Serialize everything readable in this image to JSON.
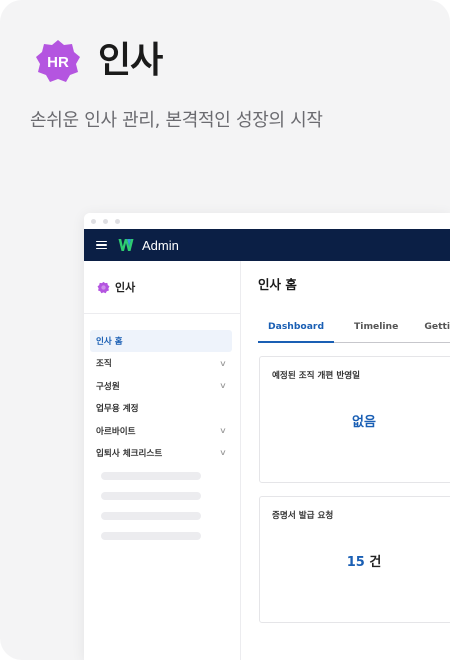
{
  "hero": {
    "icon_text": "HR",
    "title": "인사",
    "subtitle": "손쉬운 인사 관리, 본격적인 성장의 시작"
  },
  "app": {
    "name": "Admin"
  },
  "sidebar": {
    "header": "인사",
    "items": [
      {
        "label": "인사 홈",
        "active": true,
        "has_children": false
      },
      {
        "label": "조직",
        "active": false,
        "has_children": true
      },
      {
        "label": "구성원",
        "active": false,
        "has_children": true
      },
      {
        "label": "업무용 계정",
        "active": false,
        "has_children": false
      },
      {
        "label": "아르바이트",
        "active": false,
        "has_children": true
      },
      {
        "label": "입퇴사 체크리스트",
        "active": false,
        "has_children": true
      }
    ]
  },
  "main": {
    "title": "인사 홈",
    "tabs": [
      {
        "label": "Dashboard",
        "active": true
      },
      {
        "label": "Timeline",
        "active": false
      },
      {
        "label": "Getting Sta",
        "active": false
      }
    ],
    "panels": [
      {
        "title": "예정된 조직 개편 반영일",
        "value": "없음"
      },
      {
        "title": "증명서 발급 요청",
        "count": "15",
        "unit": "건"
      }
    ]
  },
  "colors": {
    "brand_purple": "#b455e0",
    "nav_bg": "#0b1f45",
    "accent_blue": "#1a5fb4"
  }
}
